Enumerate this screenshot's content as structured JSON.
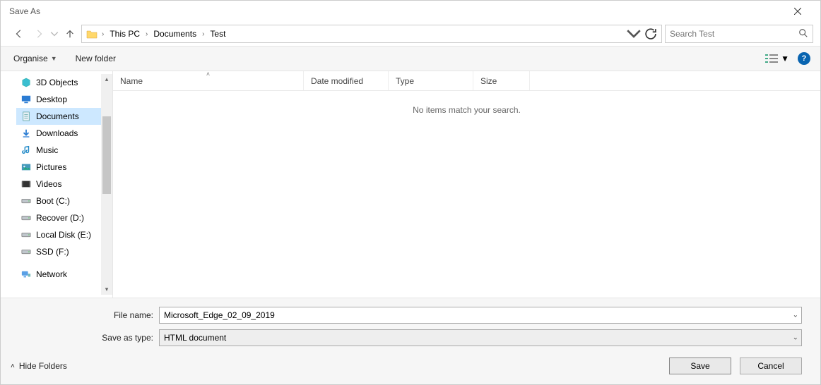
{
  "window": {
    "title": "Save As"
  },
  "nav": {
    "breadcrumb": [
      "This PC",
      "Documents",
      "Test"
    ],
    "search_placeholder": "Search Test"
  },
  "toolbar": {
    "organise_label": "Organise",
    "newfolder_label": "New folder"
  },
  "tree": {
    "items": [
      {
        "label": "3D Objects",
        "icon": "3d"
      },
      {
        "label": "Desktop",
        "icon": "desktop"
      },
      {
        "label": "Documents",
        "icon": "doc",
        "selected": true
      },
      {
        "label": "Downloads",
        "icon": "download"
      },
      {
        "label": "Music",
        "icon": "music"
      },
      {
        "label": "Pictures",
        "icon": "pic"
      },
      {
        "label": "Videos",
        "icon": "video"
      },
      {
        "label": "Boot (C:)",
        "icon": "drive"
      },
      {
        "label": "Recover (D:)",
        "icon": "drive"
      },
      {
        "label": "Local Disk (E:)",
        "icon": "drive"
      },
      {
        "label": "SSD (F:)",
        "icon": "drive"
      }
    ],
    "network_label": "Network"
  },
  "columns": {
    "name": "Name",
    "date": "Date modified",
    "type": "Type",
    "size": "Size"
  },
  "empty_text": "No items match your search.",
  "form": {
    "filename_label": "File name:",
    "filename_value": "Microsoft_Edge_02_09_2019",
    "savetype_label": "Save as type:",
    "savetype_value": "HTML document"
  },
  "footer": {
    "hide_label": "Hide Folders",
    "save_label": "Save",
    "cancel_label": "Cancel"
  }
}
